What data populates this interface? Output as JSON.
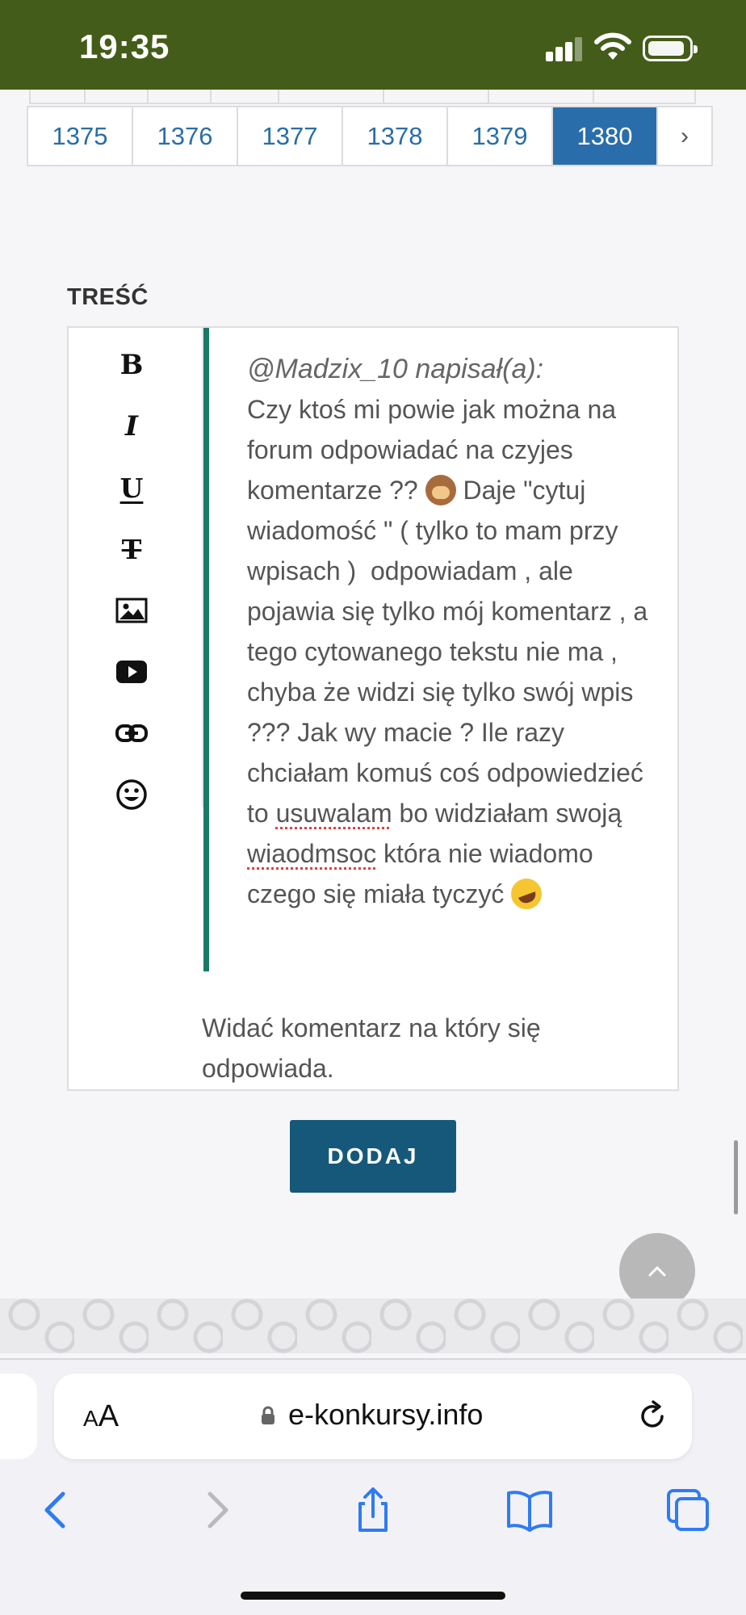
{
  "status_bar": {
    "time": "19:35"
  },
  "pagination": {
    "pages": [
      "1375",
      "1376",
      "1377",
      "1378",
      "1379",
      "1380"
    ],
    "active": "1380",
    "next_label": "›"
  },
  "form": {
    "content_label": "TREŚĆ",
    "toolbar": {
      "bold": "B",
      "italic": "I",
      "underline": "U",
      "strike": "T"
    },
    "quote_author": "@Madzix_10 napisał(a):",
    "quote_part1": "Czy ktoś mi powie jak można na forum odpowiadać na czyjes komentarze ?? ",
    "quote_part2": " Daje \"cytuj wiadomość \" ( tylko to mam przy wpisach )  odpowiadam , ale pojawia się tylko mój komentarz , a tego cytowanego tekstu nie ma , chyba że widzi się tylko swój wpis ??? Jak wy macie ? Ile razy chciałam komuś coś odpowiedzieć to ",
    "misspelled_1": "usuwalam",
    "quote_part3": " bo widziałam swoją ",
    "misspelled_2": "wiaodmsoc",
    "quote_part4": " która nie wiadomo czego się miała tyczyć ",
    "reply_text": "Widać komentarz na który się odpowiada.",
    "submit_label": "DODAJ"
  },
  "browser": {
    "text_size_label_small": "A",
    "text_size_label_large": "A",
    "url": "e-konkursy.info"
  },
  "icons": {
    "toolbar": [
      "image-icon",
      "youtube-icon",
      "link-icon",
      "emoji-icon"
    ],
    "emoji_in_text": [
      "see-no-evil-monkey-emoji",
      "rolling-laughing-emoji"
    ],
    "browser_nav": [
      "back-icon",
      "forward-icon",
      "share-icon",
      "bookmarks-icon",
      "tabs-icon"
    ]
  },
  "colors": {
    "status_bar": "#445c19",
    "active_page": "#2a6dab",
    "quote_bar": "#1a7a66",
    "submit_button": "#16587a",
    "browser_accent": "#2f7bf5"
  }
}
